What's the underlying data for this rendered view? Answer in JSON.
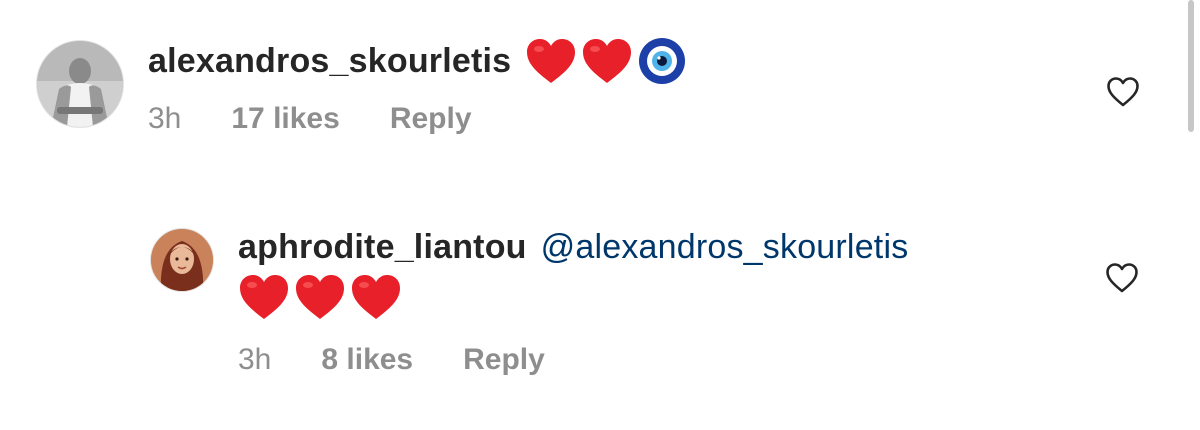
{
  "comments": [
    {
      "username": "alexandros_skourletis",
      "emojis": [
        "red-heart",
        "red-heart",
        "nazar-amulet"
      ],
      "time": "3h",
      "likes": "17 likes",
      "reply_label": "Reply"
    },
    {
      "username": "aphrodite_liantou",
      "mention": "@alexandros_skourletis",
      "emojis": [
        "red-heart",
        "red-heart",
        "red-heart"
      ],
      "time": "3h",
      "likes": "8 likes",
      "reply_label": "Reply"
    }
  ],
  "colors": {
    "username": "#262626",
    "mention": "#00376b",
    "meta": "#8e8e8e",
    "heart_emoji": "#e8202a",
    "like_icon_stroke": "#262626"
  },
  "icons": {
    "like": "heart-outline-icon",
    "avatar_top": "profile-photo-man-icon",
    "avatar_reply": "profile-photo-woman-icon"
  }
}
